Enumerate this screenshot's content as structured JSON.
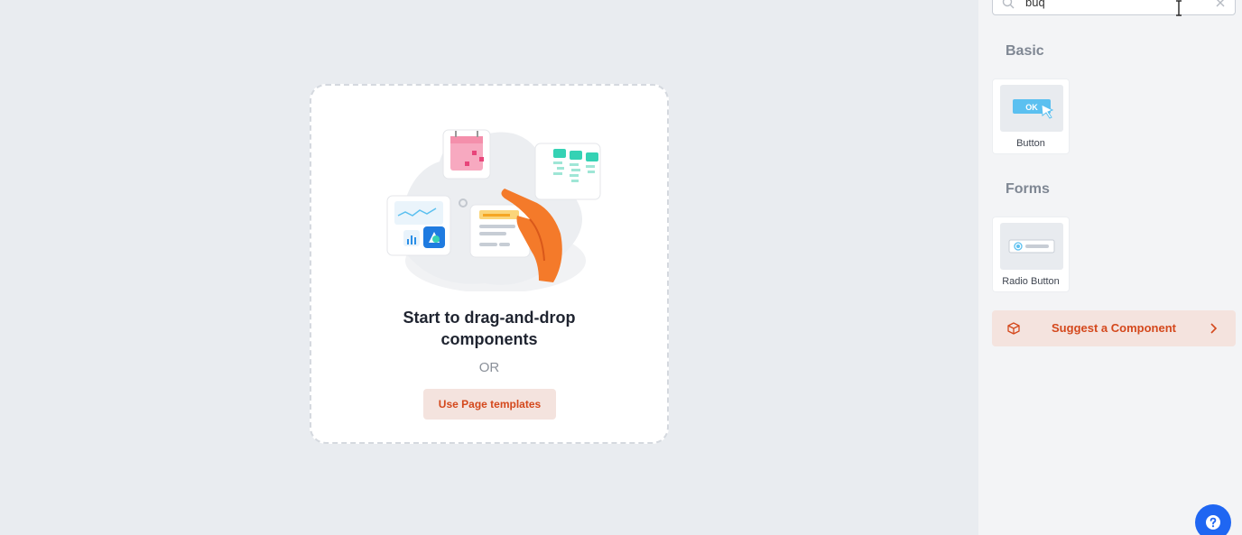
{
  "canvas": {
    "title": "Start to drag-and-drop components",
    "or_text": "OR",
    "template_button_label": "Use Page templates"
  },
  "panel": {
    "search_value": "buq",
    "sections": [
      {
        "title": "Basic",
        "components": [
          {
            "label": "Button",
            "thumbnail_icon": "button-ok-icon",
            "thumbnail_text": "OK"
          }
        ]
      },
      {
        "title": "Forms",
        "components": [
          {
            "label": "Radio Button",
            "thumbnail_icon": "radio-button-icon"
          }
        ]
      }
    ],
    "suggest_label": "Suggest a Component"
  },
  "colors": {
    "accent": "#d4481c",
    "accent_bg": "#f4e3de",
    "help": "#1f66f2",
    "thumbnail_blue": "#5bc0f0"
  }
}
